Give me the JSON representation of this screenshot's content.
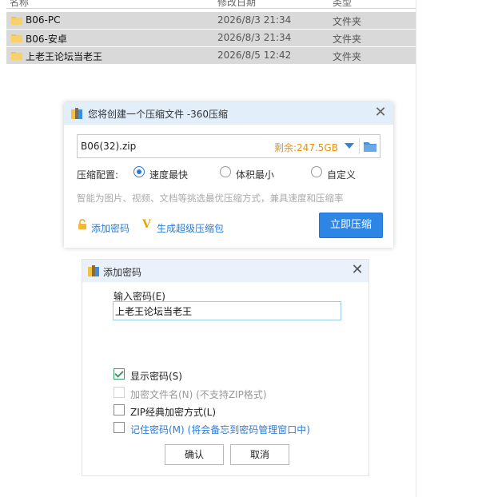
{
  "explorer": {
    "header": {
      "name": "名称",
      "date": "修改日期",
      "type": "类型"
    },
    "files": [
      {
        "name": "B06-PC",
        "date": "2026/8/3 21:34",
        "type": "文件夹"
      },
      {
        "name": "B06-安卓",
        "date": "2026/8/3 21:34",
        "type": "文件夹"
      },
      {
        "name": "上老王论坛当老王",
        "date": "2026/8/5 12:42",
        "type": "文件夹"
      }
    ]
  },
  "compress_dialog": {
    "title": "您将创建一个压缩文件 -360压缩",
    "filename": "B06(32).zip",
    "remaining": "剩余:247.5GB",
    "config_label": "压缩配置:",
    "options": [
      "速度最快",
      "体积最小",
      "自定义"
    ],
    "selected_option": "速度最快",
    "hint": "智能为图片、视频、文档等挑选最优压缩方式，兼具速度和压缩率",
    "add_password_link": "添加密码",
    "super_pack_link": "生成超级压缩包",
    "compress_button": "立即压缩"
  },
  "password_dialog": {
    "title": "添加密码",
    "input_label": "输入密码(E)",
    "password_value": "上老王论坛当老王",
    "checkboxes": [
      {
        "label": "显示密码(S)",
        "checked": true,
        "enabled": true
      },
      {
        "label": "加密文件名(N) (不支持ZIP格式)",
        "checked": false,
        "enabled": false
      },
      {
        "label": "ZIP经典加密方式(L)",
        "checked": false,
        "enabled": true
      },
      {
        "label": "记住密码(M) (将会备忘到密码管理窗口中)",
        "checked": false,
        "enabled": true
      }
    ],
    "ok_button": "确认",
    "cancel_button": "取消"
  },
  "colors": {
    "accent": "#2d86e6",
    "warning": "#e8930c",
    "selection": "#d9d9d9"
  }
}
